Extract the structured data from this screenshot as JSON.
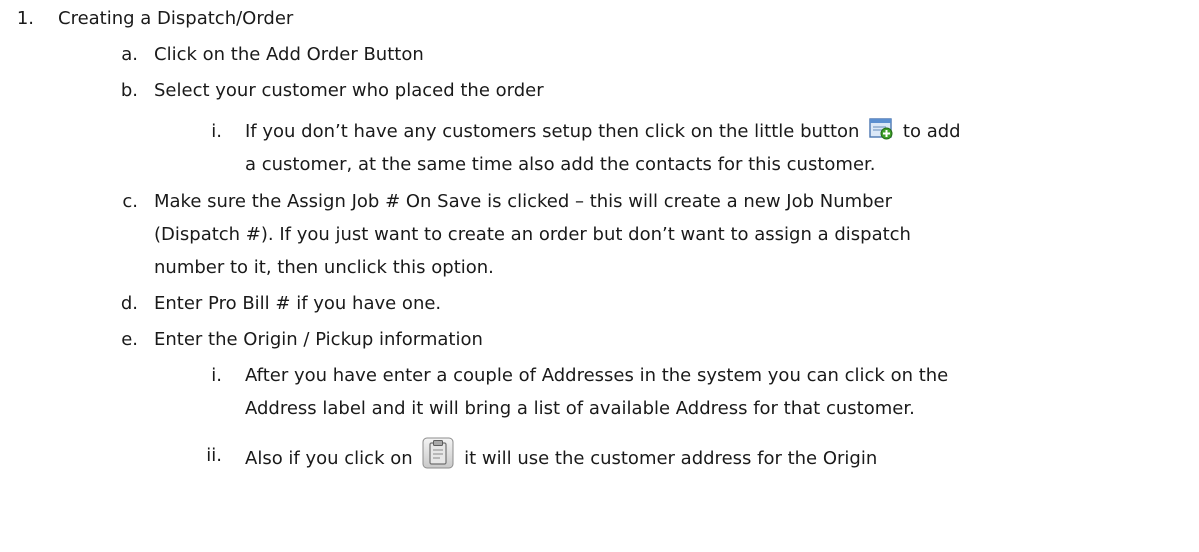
{
  "outline": {
    "item1": {
      "marker": "1.",
      "text": "Creating a Dispatch/Order"
    },
    "a": {
      "marker": "a.",
      "text": "Click on the Add Order Button"
    },
    "b": {
      "marker": "b.",
      "text": "Select your customer who placed the order"
    },
    "b_i": {
      "marker": "i.",
      "line1_before_icon": "If you don’t have any customers setup then click on the little button",
      "line1_after_icon": "to add",
      "line2": "a customer, at the same time also add the contacts for this customer."
    },
    "c": {
      "marker": "c.",
      "line1": "Make sure the Assign Job # On Save is clicked – this will create a new Job Number",
      "line2": "(Dispatch #).  If you just want to create an order but don’t want to assign a dispatch",
      "line3": "number to it, then unclick this option."
    },
    "d": {
      "marker": "d.",
      "text": "Enter Pro Bill # if you have one."
    },
    "e": {
      "marker": "e.",
      "text": "Enter the Origin / Pickup information"
    },
    "e_i": {
      "marker": "i.",
      "line1": "After you have enter a couple of Addresses in the system you can click on the",
      "line2": "Address label and it will bring a list of available Address for that customer."
    },
    "e_ii": {
      "marker": "ii.",
      "before_icon": "Also if you click on",
      "after_icon": "it will use the customer address for the Origin"
    }
  },
  "icons": {
    "add_customer": "add-customer-icon",
    "copy_address": "copy-address-icon"
  }
}
